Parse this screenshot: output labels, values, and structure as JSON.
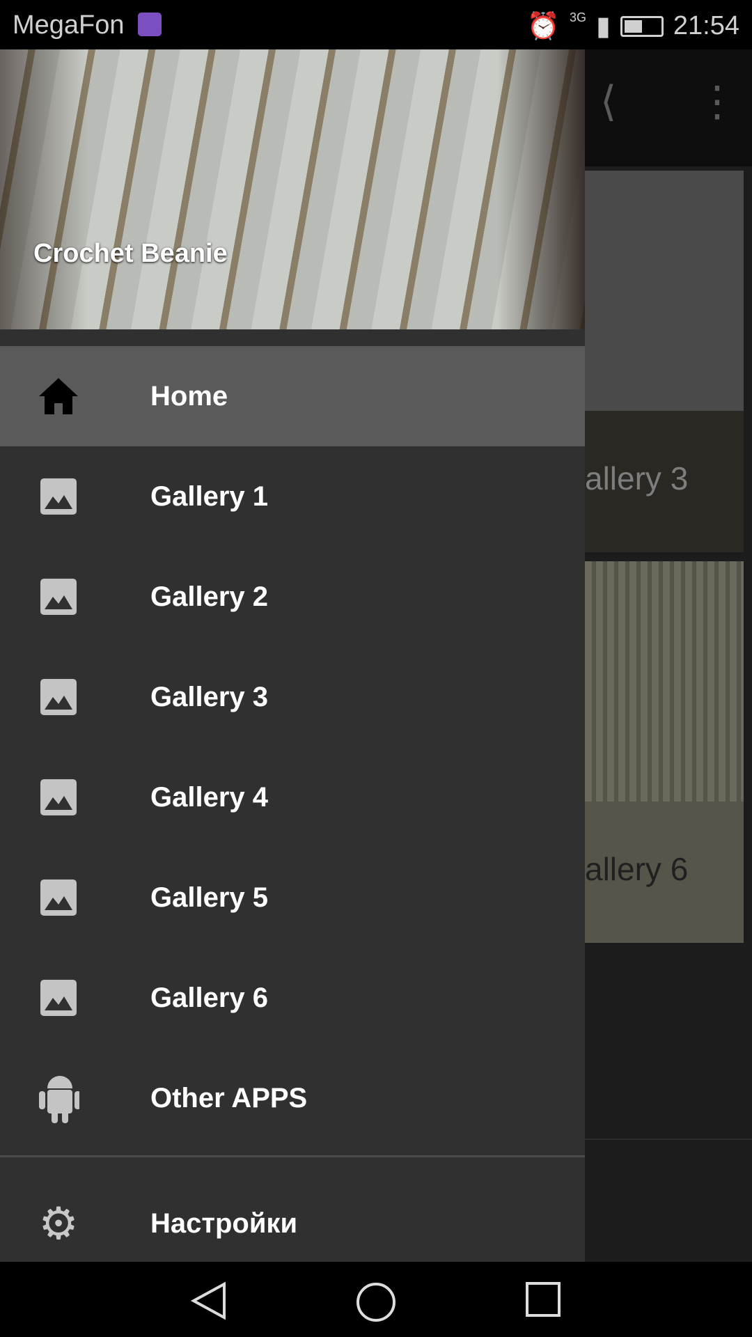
{
  "status_bar": {
    "carrier": "MegaFon",
    "network": "3G",
    "time": "21:54",
    "battery_percent": 45
  },
  "drawer": {
    "header_title": "Crochet Beanie",
    "items": [
      {
        "label": "Home",
        "icon": "home-icon",
        "active": true
      },
      {
        "label": "Gallery 1",
        "icon": "image-icon"
      },
      {
        "label": "Gallery 2",
        "icon": "image-icon"
      },
      {
        "label": "Gallery 3",
        "icon": "image-icon"
      },
      {
        "label": "Gallery 4",
        "icon": "image-icon"
      },
      {
        "label": "Gallery 5",
        "icon": "image-icon"
      },
      {
        "label": "Gallery 6",
        "icon": "image-icon"
      },
      {
        "label": "Other APPS",
        "icon": "android-icon"
      }
    ],
    "settings_label": "Настройки"
  },
  "background": {
    "cards": [
      {
        "label": "allery 3"
      },
      {
        "label": "allery 6"
      }
    ]
  },
  "colors": {
    "drawer": "#303030",
    "active": "#5a5a5a"
  }
}
